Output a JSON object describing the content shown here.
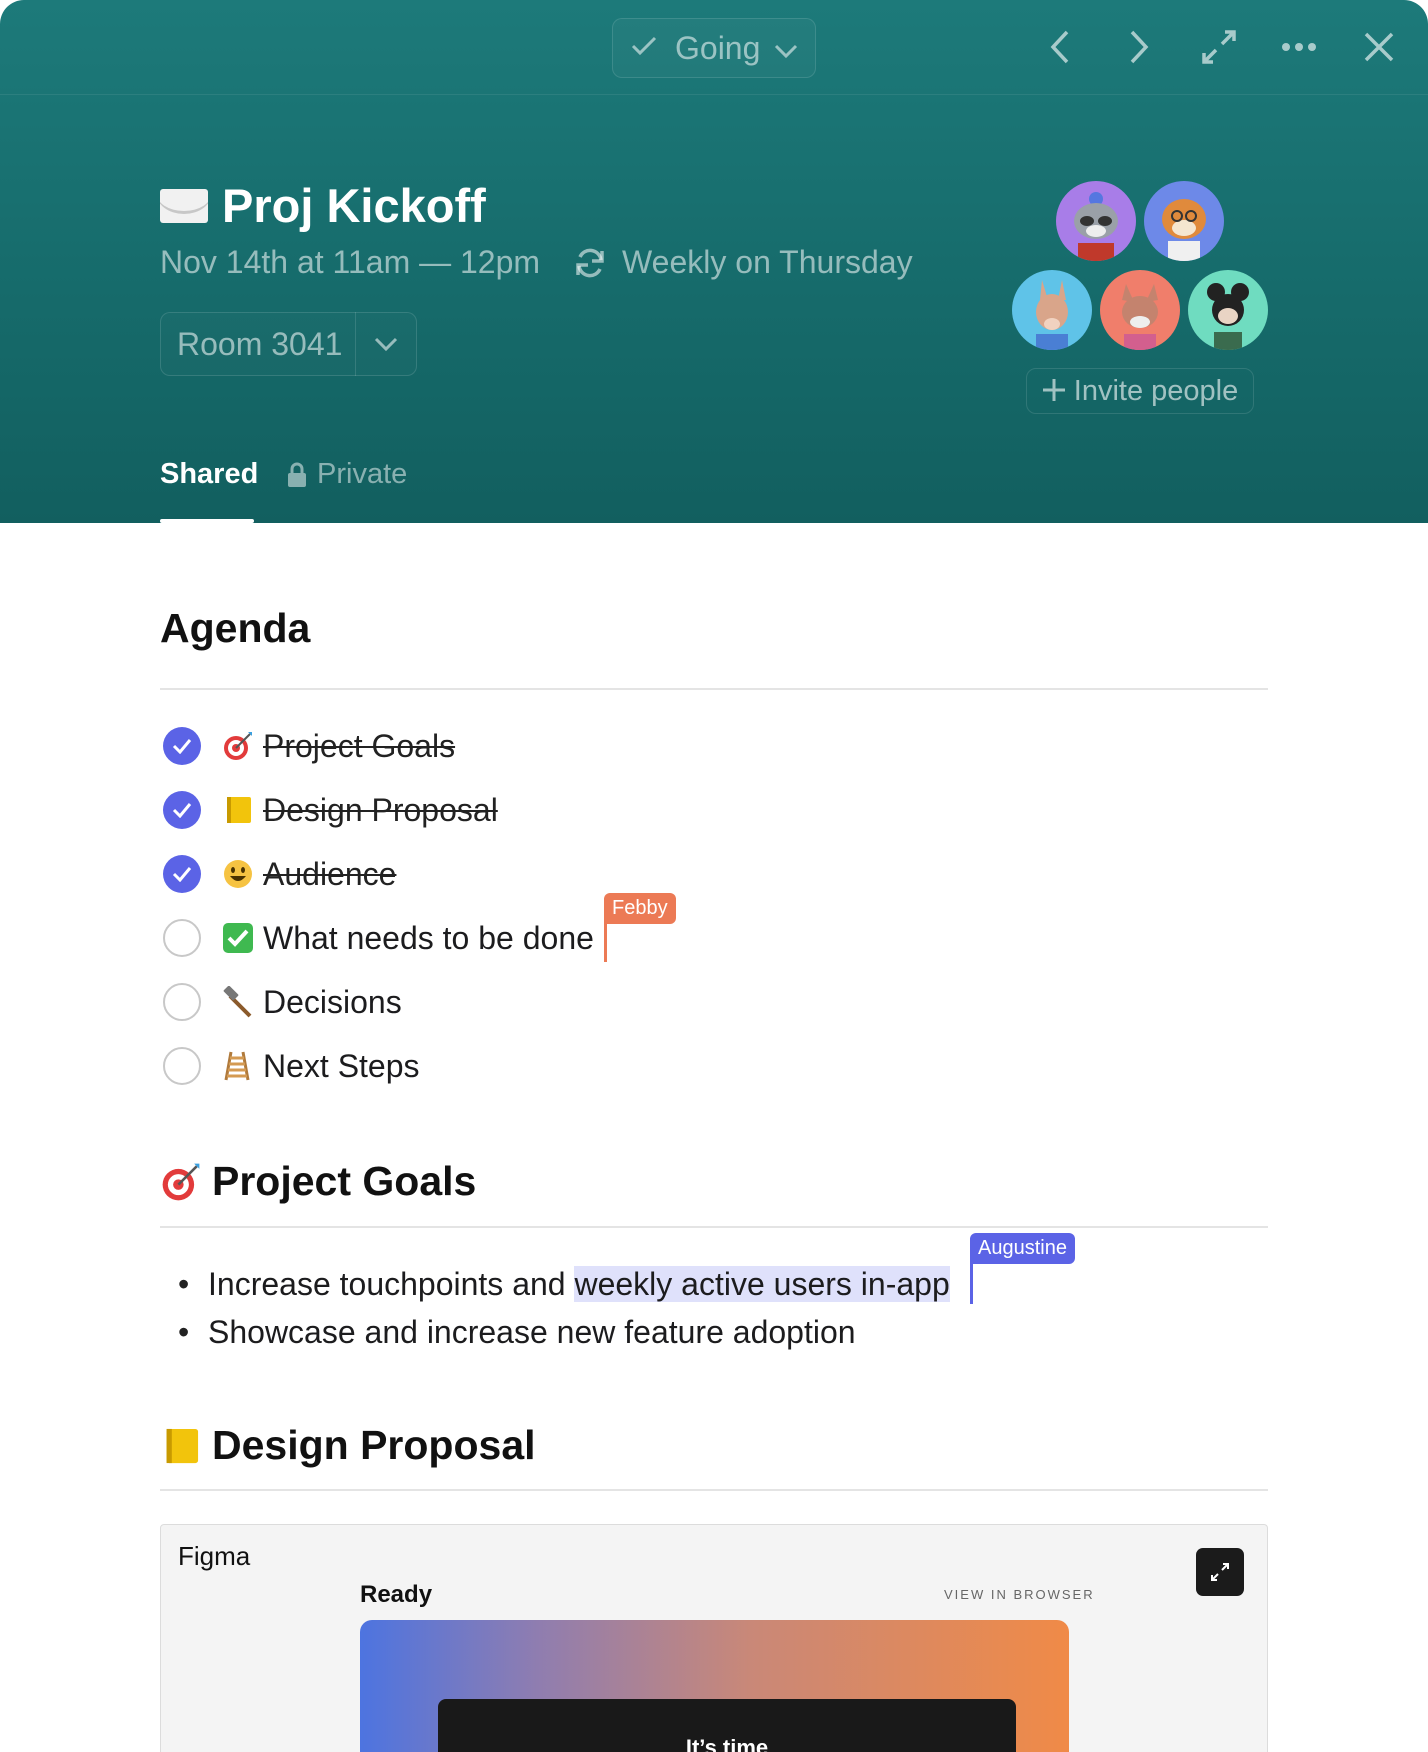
{
  "toolbar": {
    "rsvp_label": "Going",
    "icons": [
      "check-icon",
      "chevron-down-icon",
      "chevron-left-icon",
      "chevron-right-icon",
      "expand-icon",
      "more-icon",
      "close-icon"
    ]
  },
  "event": {
    "title": "Proj Kickoff",
    "datetime": "Nov 14th at 11am — 12pm",
    "recurrence": "Weekly on Thursday",
    "location": "Room 3041"
  },
  "attendees": {
    "invite_label": "Invite people",
    "avatars": [
      "raccoon",
      "tiger",
      "kangaroo",
      "fox",
      "mouse"
    ]
  },
  "tabs": {
    "shared": "Shared",
    "private": "Private"
  },
  "agenda": {
    "heading": "Agenda",
    "items": [
      {
        "label": "Project Goals",
        "emoji": "dart-icon",
        "done": true
      },
      {
        "label": "Design Proposal",
        "emoji": "notebook-icon",
        "done": true
      },
      {
        "label": "Audience",
        "emoji": "smiley-icon",
        "done": true
      },
      {
        "label": "What needs to be done",
        "emoji": "checkmark-icon",
        "done": false
      },
      {
        "label": "Decisions",
        "emoji": "hammer-icon",
        "done": false
      },
      {
        "label": "Next Steps",
        "emoji": "ladder-icon",
        "done": false
      }
    ]
  },
  "cursors": {
    "febby": "Febby",
    "augustine": "Augustine"
  },
  "goals": {
    "heading": "Project Goals",
    "bullet1_plain": "Increase touchpoints and ",
    "bullet1_highlight": "weekly active users in-app",
    "bullet2": "Showcase and increase new feature adoption"
  },
  "design": {
    "heading": "Design Proposal",
    "embed_source": "Figma",
    "frame_title": "Ready",
    "view_in_browser": "VIEW IN BROWSER",
    "preview_text": "It’s time"
  },
  "colors": {
    "header": "#1b7575",
    "checkbox_done": "#5b63e6",
    "febby_cursor": "#ec7a55",
    "augustine_cursor": "#5b63e6"
  }
}
